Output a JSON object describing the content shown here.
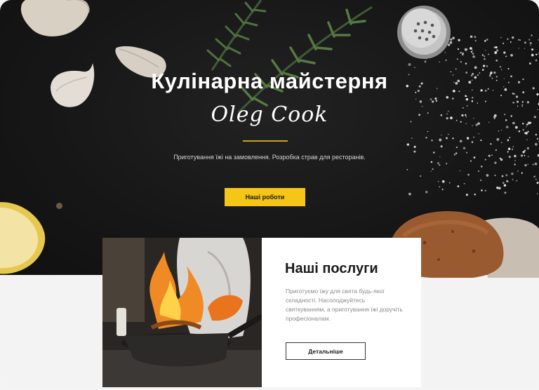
{
  "hero": {
    "title": "Кулінарна майстерня",
    "signature": "Oleg Cook",
    "subtitle": "Приготування їжі на замовлення. Розробка страв для ресторанів.",
    "button_label": "Наші роботи"
  },
  "services": {
    "title": "Наші послуги",
    "text": "Приготуємо їжу для свята будь-якої складності. Насолоджуйтесь святкуванням, а приготування їжі доручіть професіоналам.",
    "button_label": "Детальніше"
  },
  "colors": {
    "accent": "#f5c518",
    "hero_background": "#171717",
    "page_background": "#f3f3f4"
  }
}
